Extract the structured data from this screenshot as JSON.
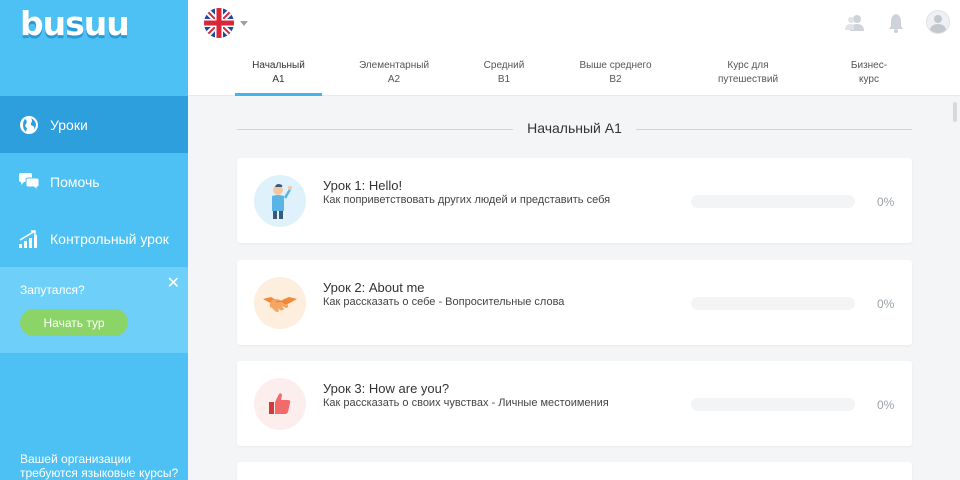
{
  "app": {
    "logo": "busuu"
  },
  "sidebar": {
    "items": [
      {
        "label": "Уроки",
        "icon": "globe-icon",
        "active": true
      },
      {
        "label": "Помочь",
        "icon": "chat-bubbles-icon",
        "active": false
      },
      {
        "label": "Контрольный урок",
        "icon": "bar-chart-icon",
        "active": false
      }
    ],
    "help": {
      "title": "Запутался?",
      "button": "Начать тур",
      "close": "✕"
    },
    "org_text": "Вашей организации требуются языковые курсы?"
  },
  "topbar": {
    "language": "english-flag",
    "icons": [
      "friends-icon",
      "bell-icon",
      "user-avatar-icon"
    ]
  },
  "tabs": [
    {
      "line1": "Начальный",
      "line2": "A1",
      "active": true
    },
    {
      "line1": "Элементарный",
      "line2": "A2",
      "active": false
    },
    {
      "line1": "Средний",
      "line2": "B1",
      "active": false
    },
    {
      "line1": "Выше среднего",
      "line2": "B2",
      "active": false
    },
    {
      "line1": "Курс для",
      "line2": "путешествий",
      "active": false
    },
    {
      "line1": "Бизнес-",
      "line2": "курс",
      "active": false
    }
  ],
  "main": {
    "section_title": "Начальный A1",
    "lessons": [
      {
        "title": "Урок 1: Hello!",
        "subtitle": "Как поприветствовать других людей и представить себя",
        "progress": "0%",
        "icon": "waving-person-icon",
        "icon_bg": "#dff2fb"
      },
      {
        "title": "Урок 2: About me",
        "subtitle": "Как рассказать о себе - Вопросительные слова",
        "progress": "0%",
        "icon": "handshake-icon",
        "icon_bg": "#fdeedd"
      },
      {
        "title": "Урок 3: How are you?",
        "subtitle": "Как рассказать о своих чувствах - Личные местоимения",
        "progress": "0%",
        "icon": "thumbs-up-icon",
        "icon_bg": "#fdeeee"
      }
    ]
  },
  "colors": {
    "sidebar": "#4ec1f4",
    "sidebar_active": "#2e9fdd",
    "accent": "#3fb4ee",
    "tour_button": "#8bd467"
  }
}
